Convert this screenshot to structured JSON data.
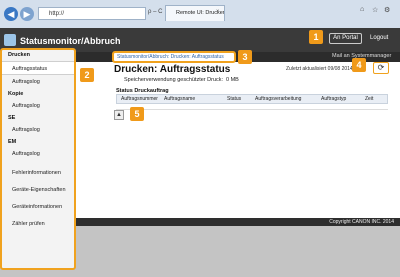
{
  "browser": {
    "address": "http://",
    "address_controls": "ρ – C",
    "tab_title": "Remote UI: Drucken: Auftra...",
    "tab_close": "×",
    "window_icons": [
      "⌂",
      "☆",
      "⚙"
    ]
  },
  "header": {
    "brand": "Statusmonitor/Abbruch",
    "portal_button": "An Portal",
    "logout": "Logout",
    "admin_mail": "Mail an Systemmanager"
  },
  "sidebar": {
    "sections": [
      {
        "heading": "Drucken",
        "items": [
          {
            "label": "Auftragsstatus",
            "active": true
          },
          {
            "label": "Auftragslog",
            "active": false
          }
        ]
      },
      {
        "heading": "Kopie",
        "items": [
          {
            "label": "Auftragslog",
            "active": false
          }
        ]
      },
      {
        "heading": "SE",
        "items": [
          {
            "label": "Auftragslog",
            "active": false
          }
        ]
      },
      {
        "heading": "EM",
        "items": [
          {
            "label": "Auftragslog",
            "active": false
          }
        ]
      }
    ],
    "extra_items": [
      "Fehlerinformationen",
      "Geräte-Eigenschaften",
      "Geräteinformationen",
      "Zähler prüfen"
    ]
  },
  "main": {
    "breadcrumb": "Statusmonitor/Abbruch: Drucken: Auftragsstatus",
    "title": "Drucken: Auftragsstatus",
    "updated": "Zuletzt aktualisiert 09/08 2014",
    "refresh_icon": "⟳",
    "memory_label": "Speicherverwendung geschützter Druck:",
    "memory_value": "0 MB",
    "section_title": "Status Druckauftrag",
    "columns": [
      "Auftragsnummer",
      "Auftragsname",
      "Status",
      "Auftragsverarbeitung",
      "Auftragstyp",
      "Zeit"
    ],
    "to_top_icon": "▲"
  },
  "footer": {
    "copyright": "Copyright CANON INC. 2014"
  },
  "callouts": [
    "1",
    "2",
    "3",
    "4",
    "5"
  ],
  "colors": {
    "accent": "#f09a1a",
    "header": "#3a3a3a",
    "link": "#3366aa"
  }
}
